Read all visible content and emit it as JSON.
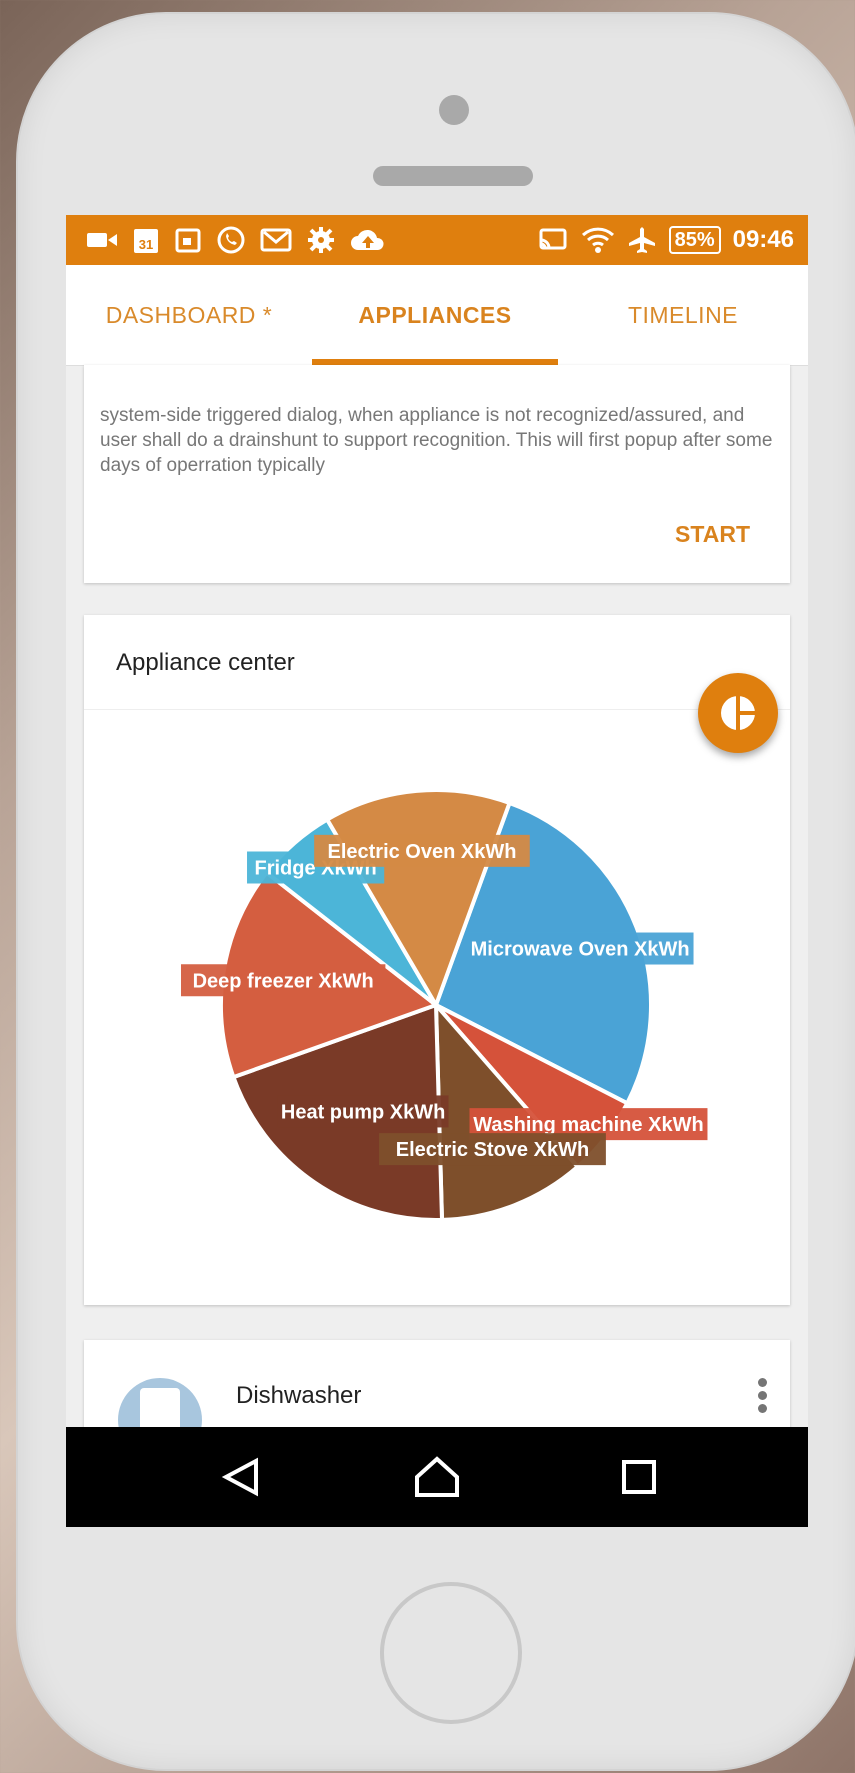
{
  "status_bar": {
    "left_icons": [
      "video-icon",
      "calendar-31-icon",
      "calendar-icon",
      "whatsapp-icon",
      "gmail-icon",
      "settings-icon",
      "cloud-upload-icon"
    ],
    "right_icons": [
      "cast-icon",
      "wifi-icon",
      "airplane-icon"
    ],
    "battery": "85%",
    "time": "09:46"
  },
  "tabs": [
    {
      "label": "DASHBOARD *",
      "active": false
    },
    {
      "label": "APPLIANCES",
      "active": true
    },
    {
      "label": "TIMELINE",
      "active": false
    }
  ],
  "dialog_card": {
    "message": "system-side triggered dialog, when appliance is not recognized/assured, and user shall do a drainshunt to support recognition. This will first popup after some days of operration typically",
    "start_label": "START"
  },
  "appliance_center": {
    "title": "Appliance center",
    "fab_icon": "pie-chart-icon"
  },
  "chart_data": {
    "type": "pie",
    "slices": [
      {
        "label": "Microwave Oven XkWh",
        "value": 27,
        "color": "#4aa3d6"
      },
      {
        "label": "Washing machine XkWh",
        "value": 6,
        "color": "#d5523a"
      },
      {
        "label": "Electric Stove XkWh",
        "value": 11,
        "color": "#7e4f2b"
      },
      {
        "label": "Heat pump XkWh",
        "value": 20,
        "color": "#7a3a27"
      },
      {
        "label": "Deep freezer XkWh",
        "value": 16,
        "color": "#d45e40"
      },
      {
        "label": "Fridge XkWh",
        "value": 6,
        "color": "#4cb5d8"
      },
      {
        "label": "Electric Oven XkWh",
        "value": 14,
        "color": "#d48a45"
      }
    ]
  },
  "appliance_list": [
    {
      "name": "Dishwasher",
      "icon": "dishwasher-icon"
    }
  ],
  "nav_bar": {
    "back_icon": "back-icon",
    "home_icon": "home-icon",
    "recents_icon": "recents-icon"
  }
}
